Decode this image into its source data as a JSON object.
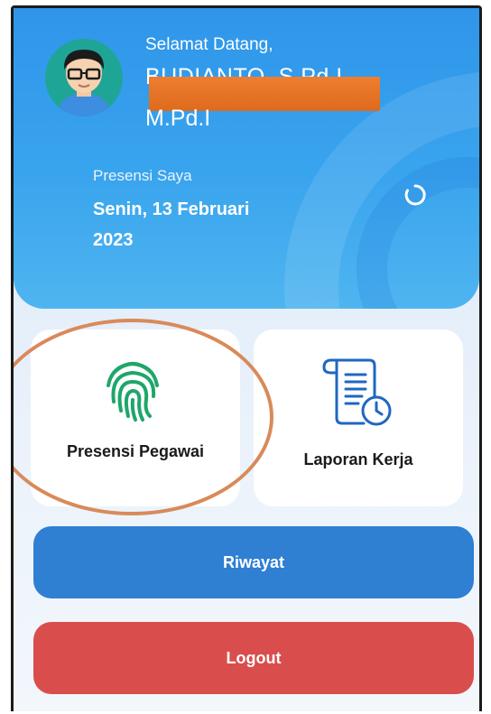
{
  "header": {
    "greeting": "Selamat Datang,",
    "name_line1": "BUDIANTO, S.Pd.I",
    "name_line2": "M.Pd.I",
    "presensi_label": "Presensi Saya",
    "presensi_date": "Senin, 13 Februari 2023"
  },
  "menu": {
    "presensi_label": "Presensi Pegawai",
    "laporan_label": "Laporan Kerja"
  },
  "buttons": {
    "riwayat": "Riwayat",
    "logout": "Logout"
  },
  "colors": {
    "header": "#3aa0ec",
    "riwayat": "#2f7fd3",
    "logout": "#d94e4c",
    "fingerprint": "#1fa66a",
    "document_icon": "#1f67c2",
    "annotation_circle": "#d98a5a"
  },
  "icons": {
    "avatar": "user-avatar-icon",
    "spinner": "loading-spinner-icon",
    "presensi": "fingerprint-icon",
    "laporan": "document-clock-icon"
  }
}
